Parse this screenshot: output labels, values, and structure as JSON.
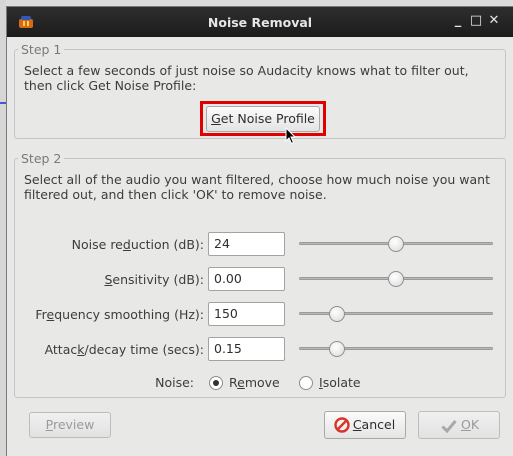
{
  "window": {
    "title": "Noise Removal",
    "controls": {
      "minimize": "_",
      "maximize": "□",
      "close": "✕"
    }
  },
  "step1": {
    "legend": "Step 1",
    "description_line1": "Select a few seconds of just noise so Audacity knows what to filter out,",
    "description_line2": "then click Get Noise Profile:",
    "button": {
      "mnemonic": "G",
      "rest": "et Noise Profile"
    },
    "highlight_color": "#e10000"
  },
  "step2": {
    "legend": "Step 2",
    "description_line1": "Select all of the audio you want filtered, choose how much noise you want",
    "description_line2": "filtered out, and then click 'OK' to remove noise.",
    "rows": [
      {
        "label_pre": "Noise re",
        "mnemonic": "d",
        "label_post": "uction (dB):",
        "value": "24",
        "slider_fraction": 0.5
      },
      {
        "label_pre": "",
        "mnemonic": "S",
        "label_post": "ensitivity (dB):",
        "value": "0.00",
        "slider_fraction": 0.5
      },
      {
        "label_pre": "Fr",
        "mnemonic": "e",
        "label_post": "quency smoothing (Hz):",
        "value": "150",
        "slider_fraction": 0.17
      },
      {
        "label_pre": "Attac",
        "mnemonic": "k",
        "label_post": "/decay time (secs):",
        "value": "0.15",
        "slider_fraction": 0.17
      }
    ],
    "noise": {
      "label": "Noise:",
      "options": [
        {
          "pre": "R",
          "mnemonic": "e",
          "post": "move",
          "selected": true
        },
        {
          "pre": "",
          "mnemonic": "I",
          "post": "solate",
          "selected": false
        }
      ]
    }
  },
  "footer": {
    "preview": {
      "mnemonic": "P",
      "rest": "review",
      "enabled": false
    },
    "cancel": {
      "mnemonic": "C",
      "rest": "ancel",
      "icon": "cancel-icon",
      "icon_color": "#d9342b"
    },
    "ok": {
      "mnemonic": "O",
      "rest": "K",
      "enabled": false,
      "icon": "checkmark-icon"
    }
  }
}
